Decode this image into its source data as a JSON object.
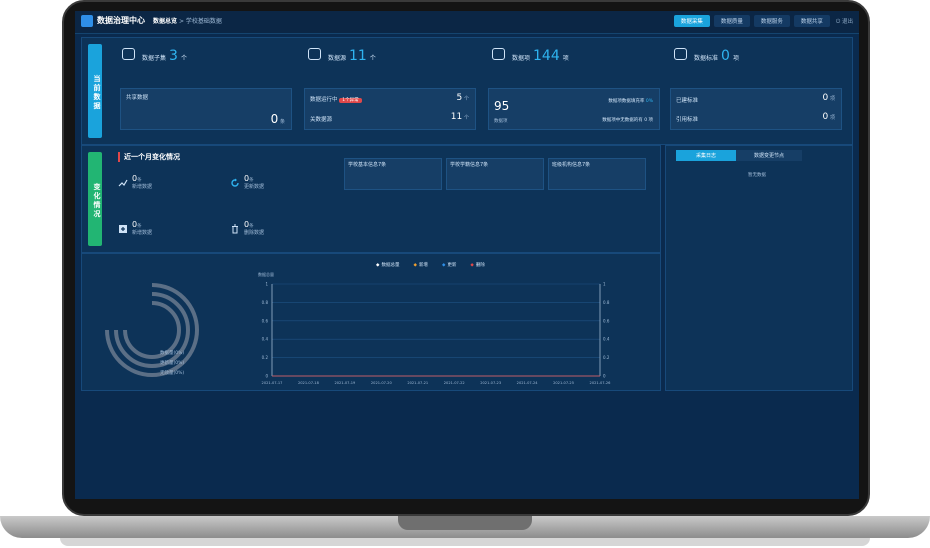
{
  "app": {
    "title": "数据治理中心",
    "breadcrumb_root": "数据总览",
    "breadcrumb_sep": ">",
    "breadcrumb_current": "学校基础数据"
  },
  "tabs": [
    {
      "label": "数据采集",
      "active": true
    },
    {
      "label": "数据质量",
      "active": false
    },
    {
      "label": "数据服务",
      "active": false
    },
    {
      "label": "数据共享",
      "active": false
    }
  ],
  "exit_label": "退出",
  "current_section": {
    "vertical_label": "当前数据",
    "stats": [
      {
        "label": "数据子集",
        "value": "3",
        "unit": "个"
      },
      {
        "label": "数据源",
        "value": "11",
        "unit": "个"
      },
      {
        "label": "数据项",
        "value": "144",
        "unit": "项"
      },
      {
        "label": "数据标准",
        "value": "0",
        "unit": "项"
      }
    ],
    "card1": {
      "title": "共享数据",
      "value": "0",
      "unit": "条"
    },
    "card2": {
      "row1_label": "数据运行中",
      "row1_badge": "1个异常",
      "row1_value": "5",
      "row1_unit": "个",
      "row2_label": "关数据源",
      "row2_value": "11",
      "row2_unit": "个"
    },
    "card3": {
      "value": "95",
      "sub": "数据项",
      "row1_label": "数据项数据填充率",
      "row1_value": "0%",
      "row2_label": "数据项中无数据的有",
      "row2_value": "0",
      "row2_unit": "项"
    },
    "card4": {
      "row1_label": "已建标准",
      "row1_value": "0",
      "row1_unit": "项",
      "row2_label": "引用标准",
      "row2_value": "0",
      "row2_unit": "项"
    }
  },
  "change_section": {
    "vertical_label": "变化情况",
    "title": "近一个月变化情况",
    "items": [
      {
        "value": "0",
        "unit": "条",
        "label": "新增数据"
      },
      {
        "value": "0",
        "unit": "条",
        "label": "更新数据"
      },
      {
        "value": "0",
        "unit": "条",
        "label": "新增数据"
      },
      {
        "value": "0",
        "unit": "条",
        "label": "删除数据"
      }
    ],
    "boxes": [
      {
        "label": "学校基本信息7条"
      },
      {
        "label": "学校学籍信息7条"
      },
      {
        "label": "班级机构信息7条"
      }
    ]
  },
  "right_panel": {
    "tabs": [
      {
        "label": "采集日志",
        "active": true
      },
      {
        "label": "数据变更节点",
        "active": false
      }
    ],
    "empty": "暂无数据"
  },
  "rings": {
    "labels": [
      "数据量(0%)",
      "更新量(0%)",
      "无效量(0%)"
    ],
    "color": "#5b6f86"
  },
  "chart_data": {
    "type": "line",
    "ylabel": "数据总量",
    "legend": [
      "数据总量",
      "新增",
      "更新",
      "删除"
    ],
    "legend_colors": [
      "#ffffff",
      "#f0a030",
      "#2f8fe8",
      "#e0484a"
    ],
    "categories": [
      "2021-07-17",
      "2021-07-18",
      "2021-07-19",
      "2021-07-20",
      "2021-07-21",
      "2021-07-22",
      "2021-07-23",
      "2021-07-24",
      "2021-07-25",
      "2021-07-26"
    ],
    "y_ticks": [
      "1",
      "0.8",
      "0.6",
      "0.4",
      "0.2",
      "0"
    ],
    "ylim": [
      0,
      1
    ],
    "series": [
      {
        "name": "数据总量",
        "values": [
          0,
          0,
          0,
          0,
          0,
          0,
          0,
          0,
          0,
          0
        ]
      },
      {
        "name": "新增",
        "values": [
          0,
          0,
          0,
          0,
          0,
          0,
          0,
          0,
          0,
          0
        ]
      },
      {
        "name": "更新",
        "values": [
          0,
          0,
          0,
          0,
          0,
          0,
          0,
          0,
          0,
          0
        ]
      },
      {
        "name": "删除",
        "values": [
          0,
          0,
          0,
          0,
          0,
          0,
          0,
          0,
          0,
          0
        ]
      }
    ]
  }
}
